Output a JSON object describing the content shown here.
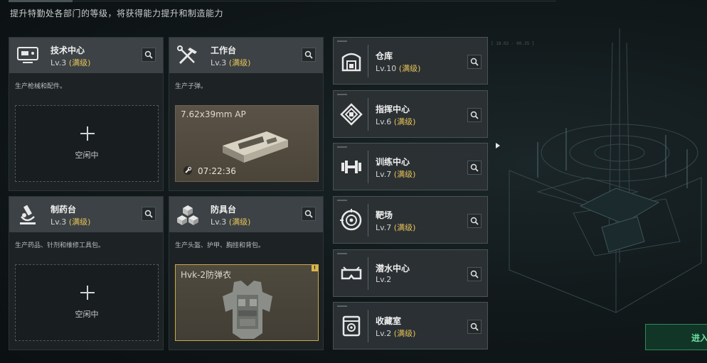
{
  "subtitle": "提升特勤处各部门的等级，将获得能力提升和制造能力",
  "colors": {
    "max_level": "#e6c35a",
    "enter_green": "#6fe0a2",
    "armor_border": "#c7a94a"
  },
  "workshops": [
    {
      "name": "技术中心",
      "level": "Lv.3",
      "max": "(满级)",
      "desc": "生产枪械和配件。",
      "icon": "computer-icon",
      "slot": {
        "state": "idle",
        "label": "空闲中"
      }
    },
    {
      "name": "工作台",
      "level": "Lv.3",
      "max": "(满级)",
      "desc": "生产子弹。",
      "icon": "tools-icon",
      "slot": {
        "state": "crafting",
        "item": "7.62x39mm AP",
        "timer": "07:22:36"
      }
    },
    {
      "name": "制药台",
      "level": "Lv.3",
      "max": "(满级)",
      "desc": "生产药品、针剂和维修工具包。",
      "icon": "microscope-icon",
      "slot": {
        "state": "idle",
        "label": "空闲中"
      }
    },
    {
      "name": "防具台",
      "level": "Lv.3",
      "max": "(满级)",
      "desc": "生产头盔、护甲、胸挂和背包。",
      "icon": "armor-blocks-icon",
      "slot": {
        "state": "crafting",
        "item": "Hvk-2防弹衣",
        "alert": "!"
      }
    }
  ],
  "facilities": [
    {
      "name": "仓库",
      "level": "Lv.10",
      "max": "(满级)",
      "icon": "warehouse-icon"
    },
    {
      "name": "指挥中心",
      "level": "Lv.6",
      "max": "(满级)",
      "icon": "command-icon"
    },
    {
      "name": "训练中心",
      "level": "Lv.7",
      "max": "(满级)",
      "icon": "dumbbell-icon"
    },
    {
      "name": "靶场",
      "level": "Lv.7",
      "max": "(满级)",
      "icon": "target-icon"
    },
    {
      "name": "潜水中心",
      "level": "Lv.2",
      "max": "",
      "icon": "dive-mask-icon"
    },
    {
      "name": "收藏室",
      "level": "Lv.2",
      "max": "(满级)",
      "icon": "collection-icon"
    }
  ],
  "enter_label": "进入"
}
